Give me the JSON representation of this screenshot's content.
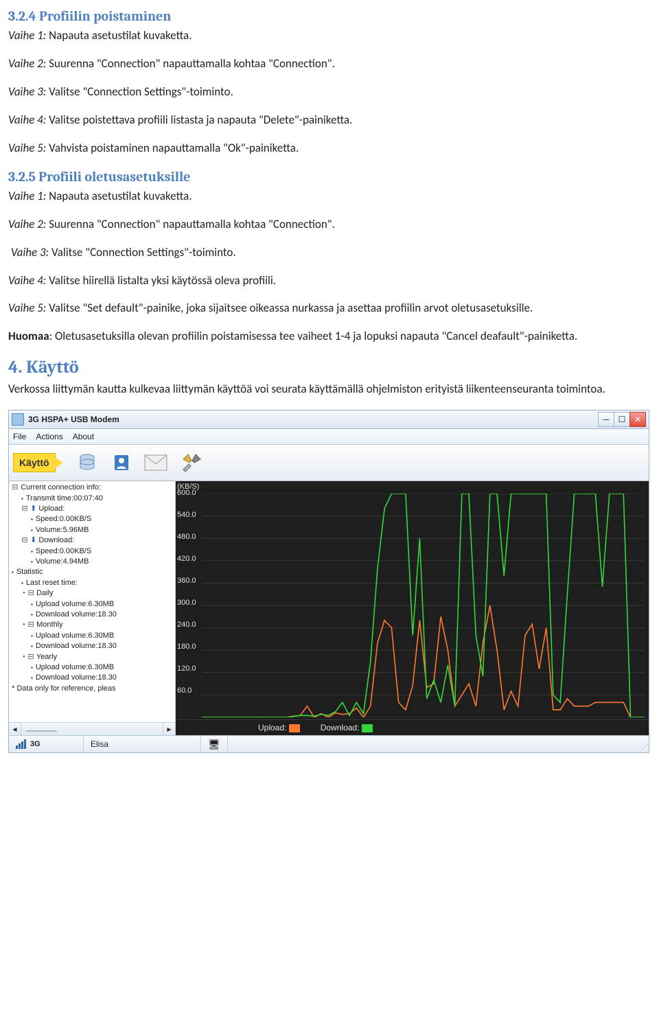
{
  "section_324": {
    "heading": "3.2.4 Profiilin poistaminen",
    "v1_label": "Vaihe 1:",
    "v1_text": " Napauta asetustilat kuvaketta.",
    "v2_label": "Vaihe 2:",
    "v2_text": " Suurenna \"Connection\" napauttamalla kohtaa \"Connection\".",
    "v3_label": "Vaihe 3:",
    "v3_text": " Valitse \"Connection Settings\"-toiminto.",
    "v4_label": "Vaihe 4:",
    "v4_text": " Valitse poistettava profiili listasta ja napauta \"Delete\"-painiketta.",
    "v5_label": "Vaihe 5:",
    "v5_text": " Vahvista poistaminen napauttamalla \"Ok\"-painiketta."
  },
  "section_325": {
    "heading": "3.2.5 Profiili oletusasetuksille",
    "v1_label": "Vaihe 1:",
    "v1_text": " Napauta asetustilat kuvaketta.",
    "v2_label": "Vaihe 2:",
    "v2_text": " Suurenna \"Connection\" napauttamalla kohtaa \"Connection\".",
    "v3_label": "Vaihe 3:",
    "v3_text": " Valitse \"Connection Settings\"-toiminto.",
    "v4_label": "Vaihe 4:",
    "v4_text": " Valitse hiirellä listalta yksi käytössä oleva profiili.",
    "v5_label": "Vaihe 5:",
    "v5_text": " Valitse \"Set default\"-painike, joka sijaitsee oikeassa nurkassa ja asettaa profiilin arvot oletusasetuksille.",
    "note_label": "Huomaa",
    "note_text": ": Oletusasetuksilla olevan profiilin poistamisessa tee vaiheet 1-4 ja lopuksi napauta \"Cancel deafault\"-painiketta."
  },
  "section_4": {
    "heading": "4. Käyttö",
    "text": "Verkossa liittymän kautta kulkevaa liittymän käyttöä voi seurata käyttämällä ohjelmiston erityistä liikenteenseuranta toimintoa."
  },
  "window": {
    "title": "3G HSPA+ USB Modem",
    "menu": {
      "file": "File",
      "actions": "Actions",
      "about": "About"
    },
    "toolbar_label": "Käyttö",
    "tree": {
      "root": "Current connection info:",
      "transmit": "Transmit time:00:07:40",
      "upload": "Upload:",
      "up_speed": "Speed:0.00KB/S",
      "up_vol": "Volume:5.96MB",
      "download": "Download:",
      "dn_speed": "Speed:0.00KB/S",
      "dn_vol": "Volume:4.94MB",
      "statistic": "Statistic",
      "last_reset": "Last reset time:",
      "daily": "Daily",
      "d_up": "Upload volume:6.30MB",
      "d_dn": "Download volume:18.30",
      "monthly": "Monthly",
      "m_up": "Upload volume:6.30MB",
      "m_dn": "Download volume:18.30",
      "yearly": "Yearly",
      "y_up": "Upload volume:6.30MB",
      "y_dn": "Download volume:18.30",
      "ref": "* Data only for reference, pleas"
    },
    "chart": {
      "ylabel": "(KB/S)",
      "legend_upload": "Upload:",
      "legend_download": "Download:",
      "upload_color": "#ff7a2d",
      "download_color": "#35d63a"
    },
    "status": {
      "network_label": "3G",
      "operator": "Elisa"
    }
  },
  "chart_data": {
    "type": "line",
    "ylabel": "(KB/S)",
    "ylim": [
      0,
      600
    ],
    "yticks": [
      0,
      60,
      120,
      180,
      240,
      300,
      360,
      420,
      480,
      540,
      600
    ],
    "x": [
      0,
      1,
      2,
      3,
      4,
      5,
      6,
      7,
      8,
      9,
      10,
      11,
      12,
      13,
      14,
      15,
      16,
      17,
      18,
      19,
      20,
      21,
      22,
      23,
      24,
      25,
      26,
      27,
      28,
      29,
      30,
      31,
      32,
      33,
      34,
      35,
      36,
      37,
      38,
      39,
      40,
      41,
      42,
      43,
      44,
      45,
      46,
      47,
      48,
      49,
      50,
      51,
      52,
      53,
      54,
      55,
      56,
      57,
      58,
      59,
      60,
      61,
      62,
      63
    ],
    "series": [
      {
        "name": "Upload",
        "color": "#ff7a2d",
        "values": [
          0,
          0,
          0,
          0,
          0,
          0,
          0,
          0,
          0,
          0,
          0,
          0,
          0,
          3,
          5,
          30,
          0,
          10,
          0,
          12,
          8,
          10,
          25,
          0,
          30,
          200,
          260,
          240,
          40,
          20,
          85,
          260,
          80,
          90,
          270,
          180,
          30,
          60,
          90,
          30,
          200,
          300,
          180,
          20,
          70,
          30,
          220,
          250,
          130,
          240,
          20,
          20,
          50,
          30,
          30,
          30,
          40,
          40,
          40,
          40,
          40,
          0,
          0,
          0
        ]
      },
      {
        "name": "Download",
        "color": "#35d63a",
        "values": [
          0,
          0,
          0,
          0,
          0,
          0,
          0,
          0,
          0,
          0,
          0,
          0,
          0,
          2,
          5,
          5,
          3,
          8,
          5,
          15,
          40,
          5,
          40,
          10,
          150,
          400,
          560,
          600,
          600,
          600,
          220,
          480,
          50,
          100,
          40,
          140,
          30,
          600,
          600,
          220,
          110,
          600,
          600,
          380,
          600,
          600,
          600,
          600,
          600,
          600,
          60,
          40,
          330,
          600,
          600,
          600,
          600,
          350,
          600,
          600,
          600,
          0,
          0,
          0
        ]
      }
    ]
  }
}
